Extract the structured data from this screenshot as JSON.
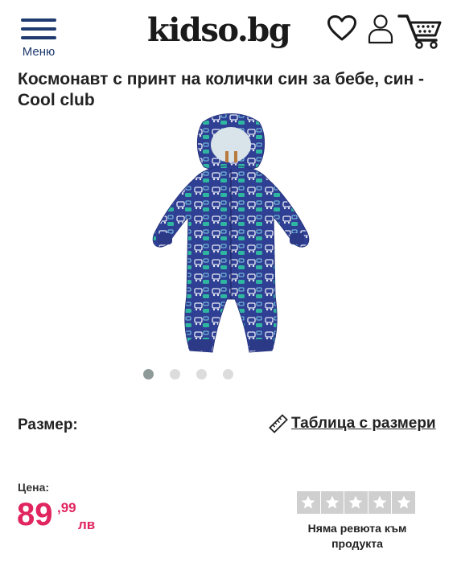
{
  "header": {
    "menu_label": "Меню",
    "logo": "kidso.bg",
    "icons": [
      "heart-icon",
      "user-icon",
      "cart-icon"
    ],
    "brand_color": "#1e3a6e"
  },
  "product": {
    "title": "Космонавт с принт на колички син за бебе, син - Cool club",
    "gallery": {
      "total_images": 4,
      "active_index": 0
    },
    "size_label": "Размер:",
    "size_table_link": "Таблица с размери",
    "price_label": "Цена:",
    "price": {
      "integer": "89",
      "decimal": ",99",
      "currency": "лв",
      "color": "#e0255f"
    },
    "rating": {
      "stars": 5,
      "filled": 0
    },
    "reviews_text": "Няма ревюта към продукта"
  }
}
